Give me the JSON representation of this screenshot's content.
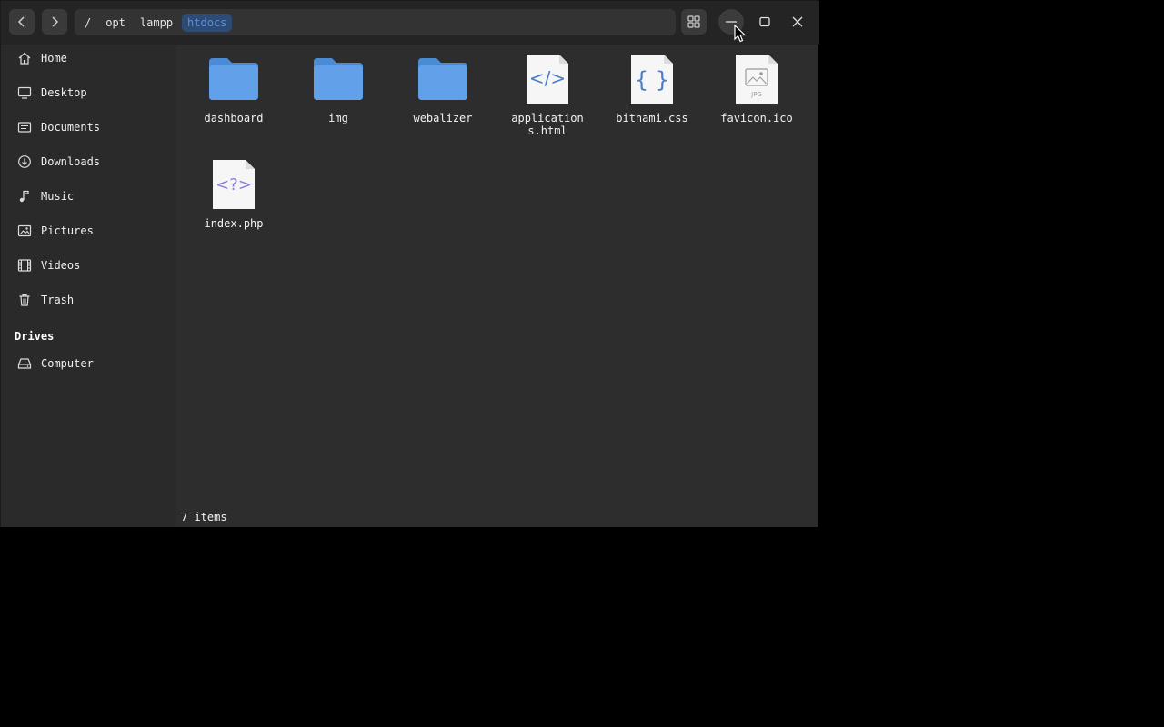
{
  "header": {
    "path": [
      "/",
      "opt",
      "lampp",
      "htdocs"
    ],
    "active_crumb": "htdocs"
  },
  "sidebar": {
    "items": [
      {
        "label": "Home",
        "icon": "home-icon"
      },
      {
        "label": "Desktop",
        "icon": "desktop-icon"
      },
      {
        "label": "Documents",
        "icon": "documents-icon"
      },
      {
        "label": "Downloads",
        "icon": "downloads-icon"
      },
      {
        "label": "Music",
        "icon": "music-icon"
      },
      {
        "label": "Pictures",
        "icon": "pictures-icon"
      },
      {
        "label": "Videos",
        "icon": "videos-icon"
      },
      {
        "label": "Trash",
        "icon": "trash-icon"
      }
    ],
    "drives_title": "Drives",
    "drives": [
      {
        "label": "Computer",
        "icon": "drive-icon"
      }
    ]
  },
  "files": [
    {
      "name": "dashboard",
      "type": "folder"
    },
    {
      "name": "img",
      "type": "folder"
    },
    {
      "name": "webalizer",
      "type": "folder"
    },
    {
      "name": "applications.html",
      "type": "html",
      "glyph": "</>"
    },
    {
      "name": "bitnami.css",
      "type": "css",
      "glyph": "{ }"
    },
    {
      "name": "favicon.ico",
      "type": "image",
      "glyph": "JPG"
    },
    {
      "name": "index.php",
      "type": "php",
      "glyph": "<?>"
    }
  ],
  "status": "7 items",
  "colors": {
    "folder": "#62a0ea",
    "folder_dark": "#4a8bd6",
    "accent": "#5b8fd9",
    "php_glyph": "#8a7fd6"
  }
}
